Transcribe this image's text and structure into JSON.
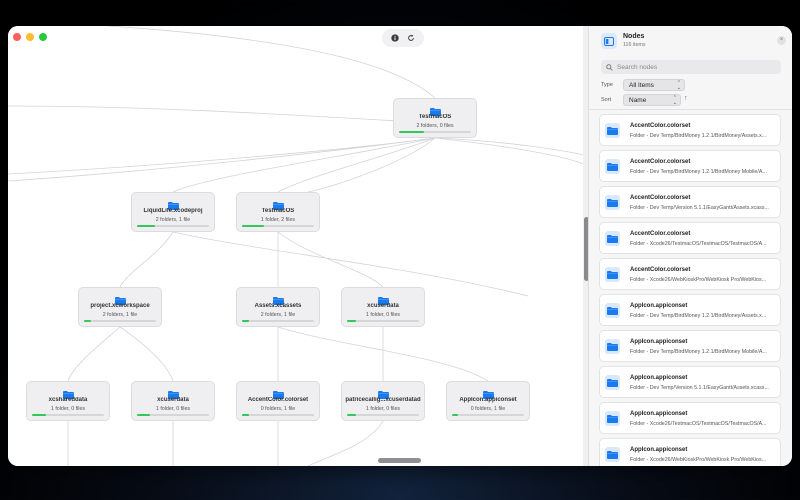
{
  "toolbar": {
    "info_icon": "info-icon",
    "refresh_icon": "refresh-icon"
  },
  "graph": {
    "nodes": [
      {
        "name": "TestmacOS",
        "sub": "2 folders, 0 files"
      },
      {
        "name": "LiquidLife.xcodeproj",
        "sub": "2 folders, 1 file"
      },
      {
        "name": "TestmacOS",
        "sub": "1 folder, 2 files"
      },
      {
        "name": "project.xcworkspace",
        "sub": "2 folders, 1 file"
      },
      {
        "name": "Assets.xcassets",
        "sub": "2 folders, 1 file"
      },
      {
        "name": "xcuserdata",
        "sub": "1 folder, 0 files"
      },
      {
        "name": "xcshareddata",
        "sub": "1 folder, 0 files"
      },
      {
        "name": "xcuserdata",
        "sub": "1 folder, 0 files"
      },
      {
        "name": "AccentColor.colorset",
        "sub": "0 folders, 1 file"
      },
      {
        "name": "patricecallig...xcuserdatad",
        "sub": "1 folder, 0 files"
      },
      {
        "name": "AppIcon.appiconset",
        "sub": "0 folders, 1 file"
      }
    ]
  },
  "sidebar": {
    "title": "Nodes",
    "count": "116 items",
    "search_placeholder": "Search nodes",
    "type_label": "Type",
    "type_value": "All Items",
    "sort_label": "Sort",
    "sort_value": "Name",
    "items": [
      {
        "name": "AccentColor.colorset",
        "path": "Folder - Dev Temp/BirdMoney 1.2.1/BirdMoney/Assets.x..."
      },
      {
        "name": "AccentColor.colorset",
        "path": "Folder - Dev Temp/BirdMoney 1.2.1/BirdMoney Mobile/A..."
      },
      {
        "name": "AccentColor.colorset",
        "path": "Folder - Dev Temp/Version 5.1.1/EasyGantt/Assets.xcass..."
      },
      {
        "name": "AccentColor.colorset",
        "path": "Folder - Xcode26/TestmacOS/TestmacOS/TestmacOS/A..."
      },
      {
        "name": "AccentColor.colorset",
        "path": "Folder - Xcode26/WebKioskPro/WebKiosk Pro/WebKios..."
      },
      {
        "name": "AppIcon.appiconset",
        "path": "Folder - Dev Temp/BirdMoney 1.2.1/BirdMoney/Assets.x..."
      },
      {
        "name": "AppIcon.appiconset",
        "path": "Folder - Dev Temp/BirdMoney 1.2.1/BirdMoney Mobile/A..."
      },
      {
        "name": "AppIcon.appiconset",
        "path": "Folder - Dev Temp/Version 5.1.1/EasyGantt/Assets.xcass..."
      },
      {
        "name": "AppIcon.appiconset",
        "path": "Folder - Xcode26/TestmacOS/TestmacOS/TestmacOS/A..."
      },
      {
        "name": "AppIcon.appiconset",
        "path": "Folder - Xcode26/WebKioskPro/WebKiosk Pro/WebKios..."
      }
    ]
  },
  "colors": {
    "accent": "#1a7bf0",
    "progress": "#34c759"
  }
}
